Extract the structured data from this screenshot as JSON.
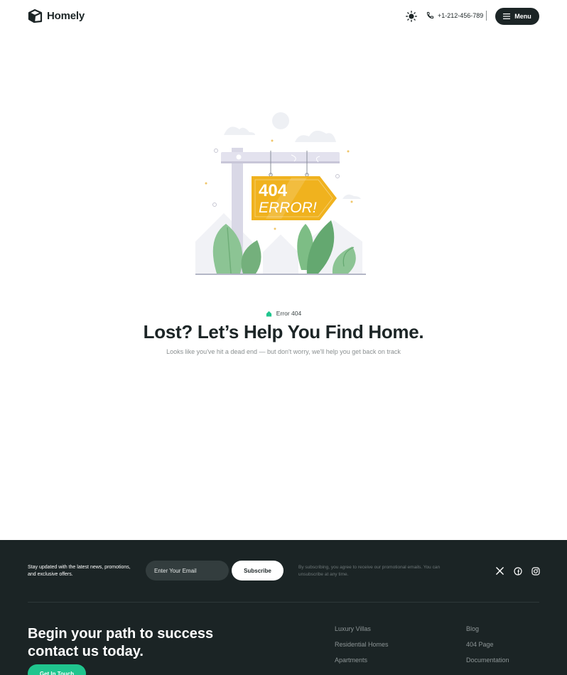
{
  "header": {
    "brand": "Homely",
    "phone": "+1-212-456-789",
    "menu_label": "Menu"
  },
  "illustration": {
    "sign_line1": "404",
    "sign_line2": "ERROR!"
  },
  "hero": {
    "tag": "Error 404",
    "title": "Lost? Let’s Help You Find Home.",
    "subtitle": "Looks like you've hit a dead end — but don't worry, we'll help you get back on track"
  },
  "footer": {
    "newsletter_text": "Stay updated with the latest news, promotions, and exclusive offers.",
    "email_placeholder": "Enter Your Email",
    "subscribe_label": "Subscribe",
    "consent": "By subscribing, you agree to receive our promotional emails. You can unsubscribe at any time.",
    "cta_title": "Begin your path to success contact us today.",
    "cta_button": "Get In Touch",
    "links_col1": [
      "Luxury Villas",
      "Residential Homes",
      "Apartments"
    ],
    "links_col2": [
      "Blog",
      "404 Page",
      "Documentation"
    ]
  },
  "colors": {
    "dark": "#1b2425",
    "accent": "#20c58e",
    "sign": "#f0b21e"
  },
  "icons": {
    "logo": "house-logo-icon",
    "theme": "sun-icon",
    "phone": "phone-icon",
    "menu": "hamburger-icon",
    "tag": "house-icon",
    "socials": [
      "x-twitter-icon",
      "facebook-icon",
      "instagram-icon"
    ]
  }
}
